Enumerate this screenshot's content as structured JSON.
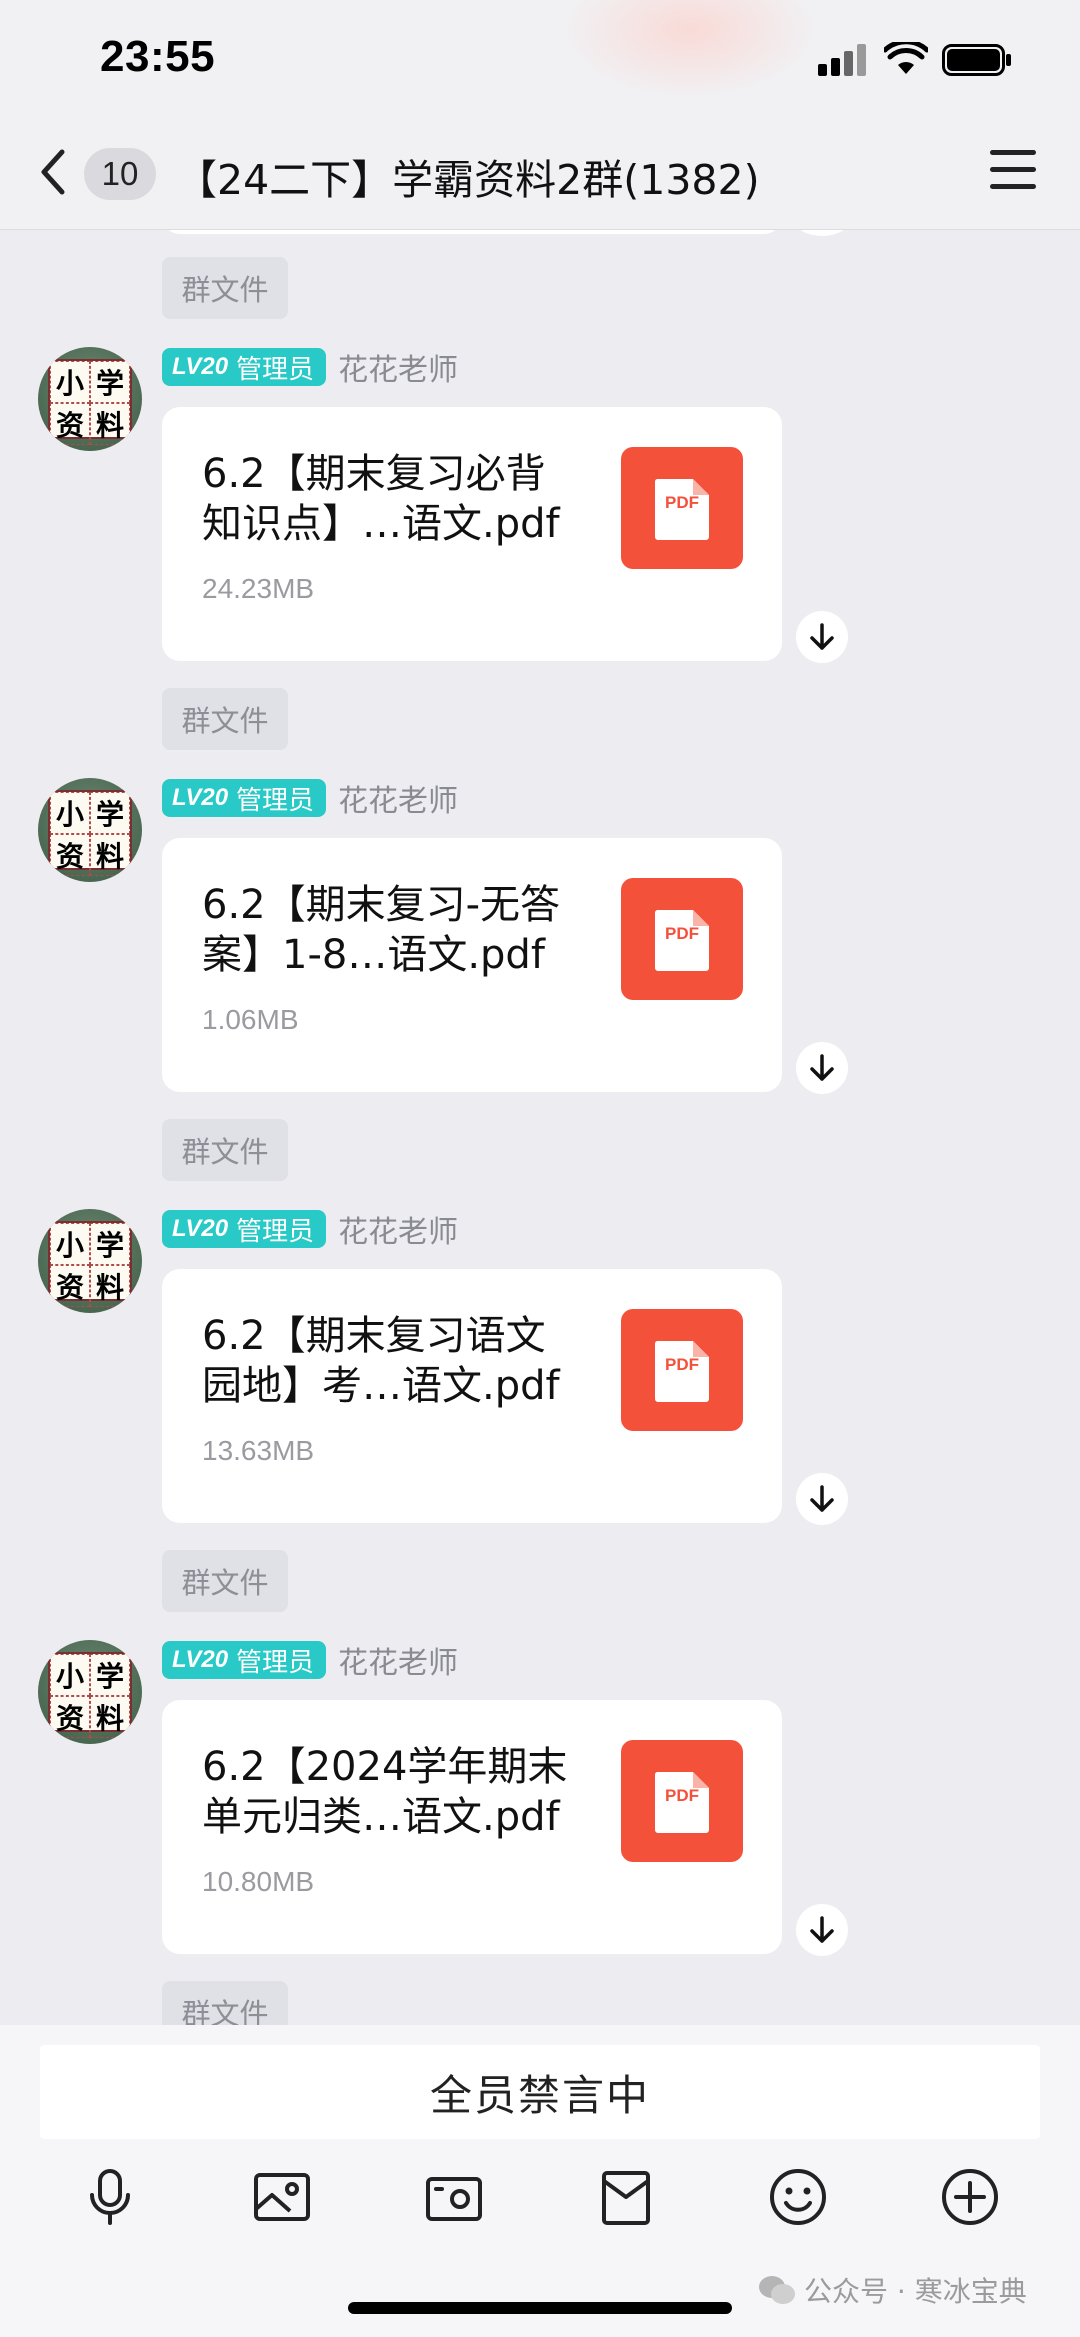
{
  "status_bar": {
    "time": "23:55"
  },
  "header": {
    "unread_count": "10",
    "title": "【24二下】学霸资料2群(1382)"
  },
  "avatar_chars": [
    "小",
    "学",
    "资",
    "料"
  ],
  "system_tag": "群文件",
  "sender": {
    "level": "20",
    "level_prefix": "LV",
    "role": "管理员",
    "name": "花花老师"
  },
  "messages": [
    {
      "file_name": "6.2【期末复习必背\n知识点】…语文.pdf",
      "size": "24.23MB",
      "file_type": "PDF"
    },
    {
      "file_name": "6.2【期末复习-无答\n案】1-8…语文.pdf",
      "size": "1.06MB",
      "file_type": "PDF"
    },
    {
      "file_name": "6.2【期末复习语文\n园地】考…语文.pdf",
      "size": "13.63MB",
      "file_type": "PDF"
    },
    {
      "file_name": "6.2【2024学年期末\n单元归类…语文.pdf",
      "size": "10.80MB",
      "file_type": "PDF"
    }
  ],
  "footer": {
    "muted_text": "全员禁言中",
    "tools": [
      "microphone-icon",
      "image-icon",
      "camera-icon",
      "red-packet-icon",
      "emoji-icon",
      "plus-icon"
    ]
  },
  "watermark": "公众号 · 寒冰宝典",
  "colors": {
    "accent_badge": "#28c9c6",
    "pdf_red": "#f4513b",
    "background": "#ededf1"
  }
}
